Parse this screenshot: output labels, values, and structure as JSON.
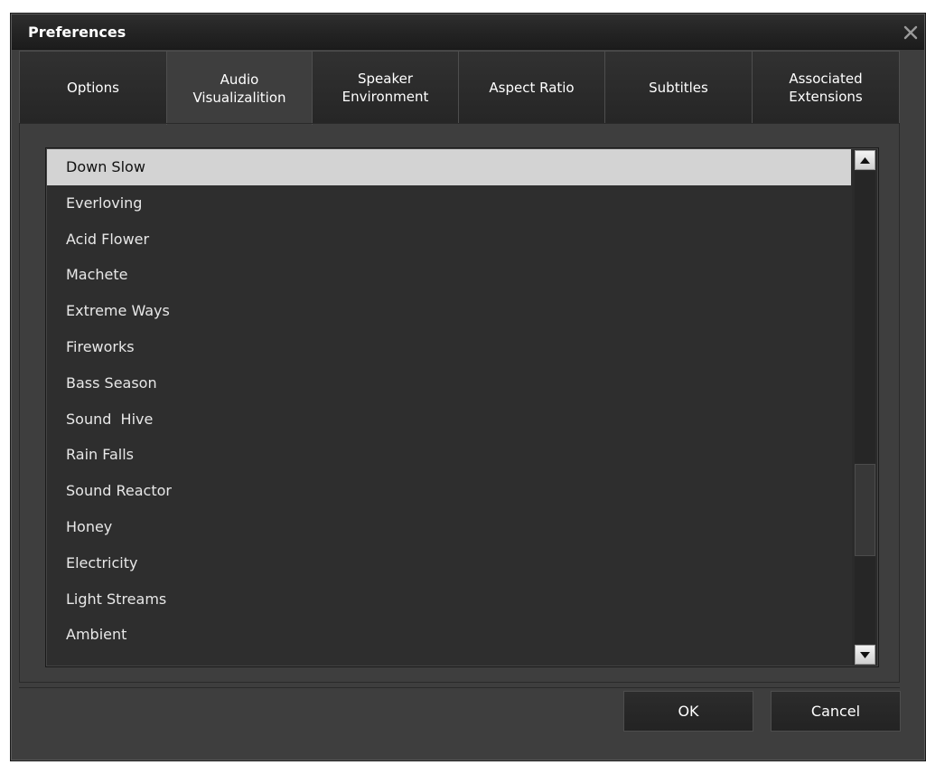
{
  "window": {
    "title": "Preferences",
    "close_icon": "close-icon"
  },
  "tabs": [
    {
      "label": "Options",
      "active": false
    },
    {
      "label": "Audio\nVisualizalition",
      "active": true
    },
    {
      "label": "Speaker\nEnvironment",
      "active": false
    },
    {
      "label": "Aspect Ratio",
      "active": false
    },
    {
      "label": "Subtitles",
      "active": false
    },
    {
      "label": "Associated\nExtensions",
      "active": false
    }
  ],
  "visualizations": {
    "selected": "Down Slow",
    "items": [
      "Down Slow",
      "Everloving",
      "Acid Flower",
      "Machete",
      "Extreme Ways",
      "Fireworks",
      "Bass Season",
      "Sound  Hive",
      "Rain Falls",
      "Sound Reactor",
      "Honey",
      "Electricity",
      "Light Streams",
      "Ambient"
    ],
    "scroll_position": 0.77
  },
  "buttons": {
    "ok_label": "OK",
    "cancel_label": "Cancel"
  },
  "colors": {
    "background": "#3e3e3e",
    "selected_row": "#d3d3d3",
    "text": "#ffffff"
  }
}
